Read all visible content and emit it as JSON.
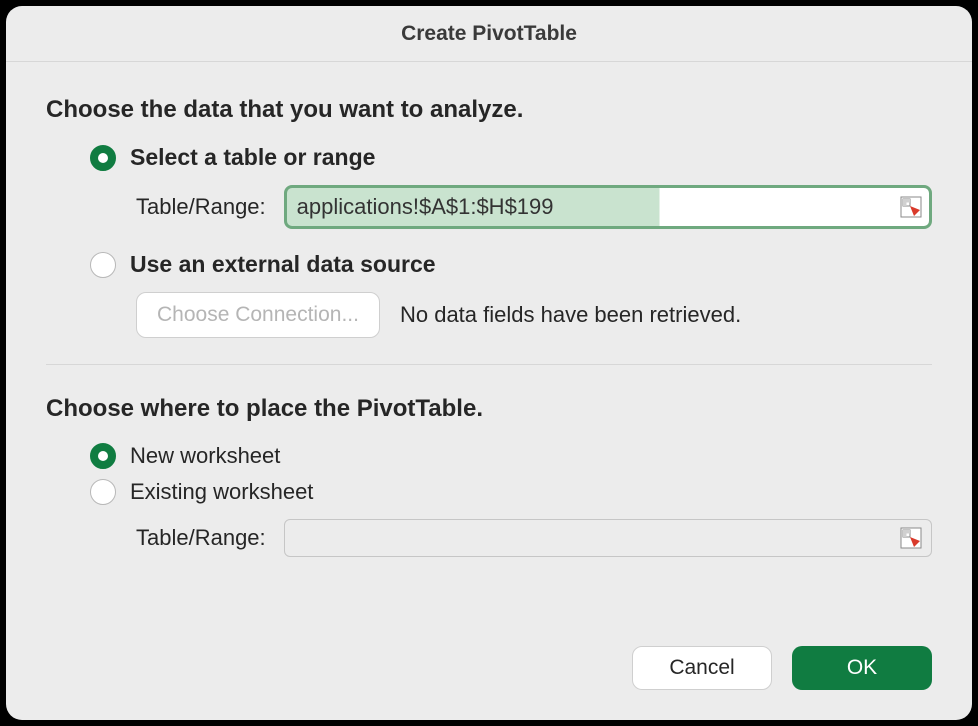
{
  "dialog": {
    "title": "Create PivotTable"
  },
  "source": {
    "heading": "Choose the data that you want to analyze.",
    "select_range_label": "Select a table or range",
    "select_range_checked": true,
    "table_range_label": "Table/Range:",
    "table_range_value": "applications!$A$1:$H$199",
    "external_label": "Use an external data source",
    "external_checked": false,
    "choose_connection_label": "Choose Connection...",
    "no_fields_text": "No data fields have been retrieved."
  },
  "placement": {
    "heading": "Choose where to place the PivotTable.",
    "new_ws_label": "New worksheet",
    "new_ws_checked": true,
    "existing_ws_label": "Existing worksheet",
    "existing_ws_checked": false,
    "table_range_label": "Table/Range:",
    "table_range_value": ""
  },
  "buttons": {
    "cancel": "Cancel",
    "ok": "OK"
  },
  "colors": {
    "accent": "#107c41"
  }
}
